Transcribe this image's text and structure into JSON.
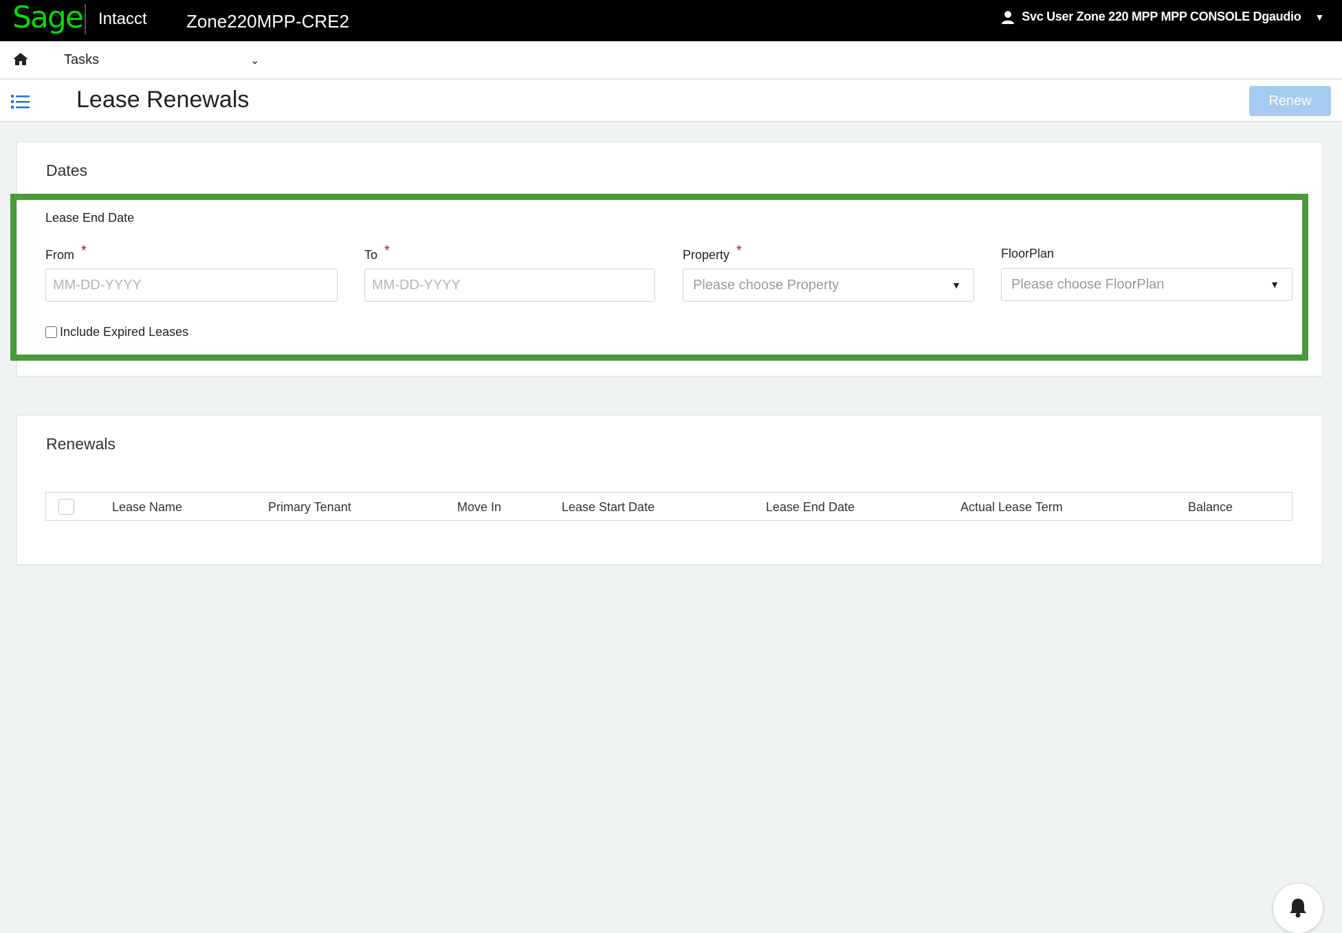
{
  "topbar": {
    "brand": "Sage",
    "product": "Intacct",
    "company": "Zone220MPP-CRE2",
    "user": "Svc User Zone 220 MPP MPP CONSOLE Dgaudio"
  },
  "nav": {
    "tasks_label": "Tasks"
  },
  "page": {
    "title": "Lease Renewals",
    "renew_label": "Renew"
  },
  "dates_card": {
    "title": "Dates",
    "group_label": "Lease End Date",
    "from_label": "From",
    "from_placeholder": "MM-DD-YYYY",
    "to_label": "To",
    "to_placeholder": "MM-DD-YYYY",
    "property_label": "Property",
    "property_placeholder": "Please choose Property",
    "floorplan_label": "FloorPlan",
    "floorplan_placeholder": "Please choose FloorPlan",
    "required_mark": "*",
    "include_expired_label": "Include Expired Leases"
  },
  "renewals_card": {
    "title": "Renewals",
    "columns": [
      "Lease Name",
      "Primary Tenant",
      "Move In",
      "Lease Start Date",
      "Lease End Date",
      "Actual Lease Term",
      "Balance"
    ]
  },
  "colors": {
    "brand_green": "#00dc00",
    "highlight_green": "#4a9a3b",
    "primary_disabled": "#a6cbf0",
    "required_red": "#cc0000"
  }
}
